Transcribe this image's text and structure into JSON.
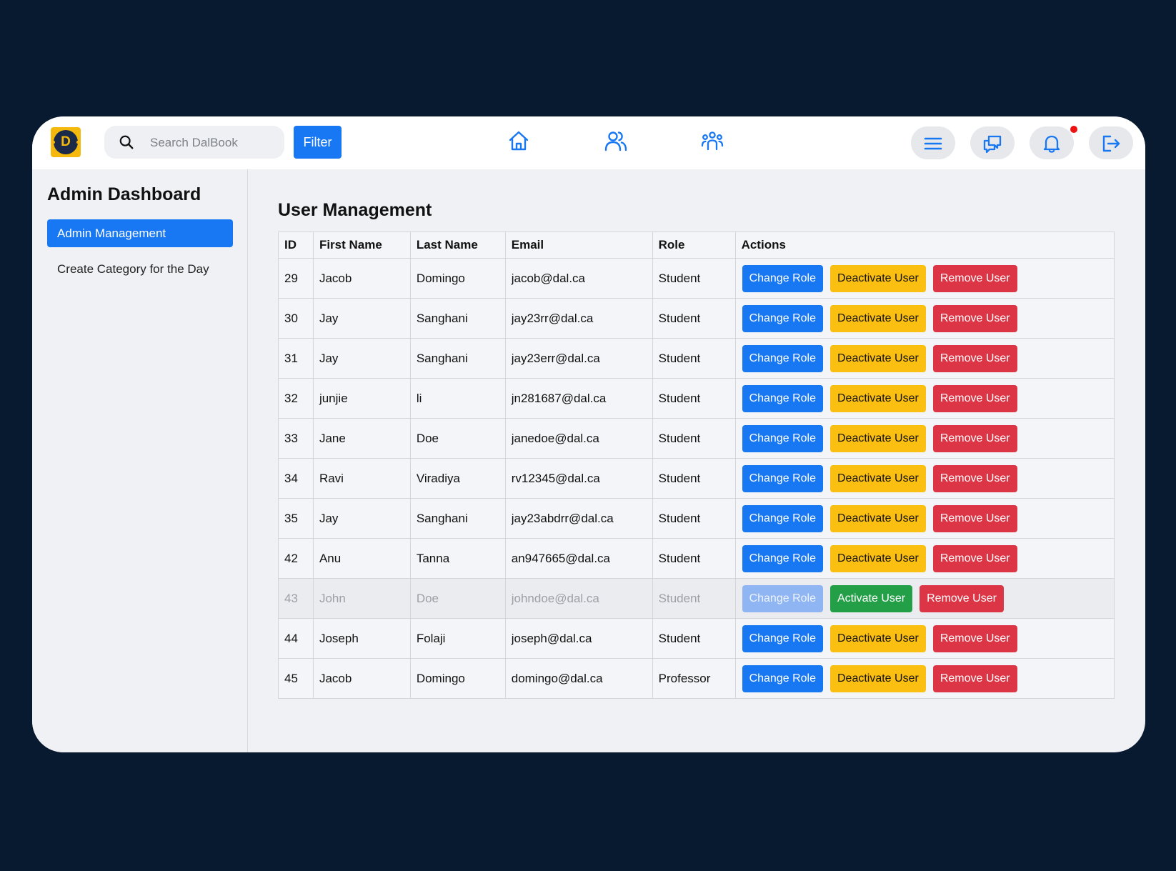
{
  "app": {
    "logo_letter": "D",
    "search_placeholder": "Search DalBook",
    "filter_label": "Filter",
    "nav_icons": [
      "home-icon",
      "friends-icon",
      "groups-icon"
    ],
    "toolbar_icons": [
      "menu-icon",
      "messages-icon",
      "bell-icon",
      "logout-icon"
    ],
    "notification_indicator": true
  },
  "sidebar": {
    "title": "Admin Dashboard",
    "items": [
      {
        "label": "Admin Management",
        "active": true
      },
      {
        "label": "Create Category for the Day",
        "active": false
      }
    ]
  },
  "main": {
    "title": "User Management",
    "columns": [
      "ID",
      "First Name",
      "Last Name",
      "Email",
      "Role",
      "Actions"
    ],
    "rows": [
      {
        "id": "29",
        "first": "Jacob",
        "last": "Domingo",
        "email": "jacob@dal.ca",
        "role": "Student",
        "status_action": "Deactivate User",
        "active": true
      },
      {
        "id": "30",
        "first": "Jay",
        "last": "Sanghani",
        "email": "jay23rr@dal.ca",
        "role": "Student",
        "status_action": "Deactivate User",
        "active": true
      },
      {
        "id": "31",
        "first": "Jay",
        "last": "Sanghani",
        "email": "jay23err@dal.ca",
        "role": "Student",
        "status_action": "Deactivate User",
        "active": true
      },
      {
        "id": "32",
        "first": "junjie",
        "last": "li",
        "email": "jn281687@dal.ca",
        "role": "Student",
        "status_action": "Deactivate User",
        "active": true
      },
      {
        "id": "33",
        "first": "Jane",
        "last": "Doe",
        "email": "janedoe@dal.ca",
        "role": "Student",
        "status_action": "Deactivate User",
        "active": true
      },
      {
        "id": "34",
        "first": "Ravi",
        "last": "Viradiya",
        "email": "rv12345@dal.ca",
        "role": "Student",
        "status_action": "Deactivate User",
        "active": true
      },
      {
        "id": "35",
        "first": "Jay",
        "last": "Sanghani",
        "email": "jay23abdrr@dal.ca",
        "role": "Student",
        "status_action": "Deactivate User",
        "active": true
      },
      {
        "id": "42",
        "first": "Anu",
        "last": "Tanna",
        "email": "an947665@dal.ca",
        "role": "Student",
        "status_action": "Deactivate User",
        "active": true
      },
      {
        "id": "43",
        "first": "John",
        "last": "Doe",
        "email": "johndoe@dal.ca",
        "role": "Student",
        "status_action": "Activate User",
        "active": false
      },
      {
        "id": "44",
        "first": "Joseph",
        "last": "Folaji",
        "email": "joseph@dal.ca",
        "role": "Student",
        "status_action": "Deactivate User",
        "active": true
      },
      {
        "id": "45",
        "first": "Jacob",
        "last": "Domingo",
        "email": "domingo@dal.ca",
        "role": "Professor",
        "status_action": "Deactivate User",
        "active": true
      }
    ],
    "change_role_label": "Change Role",
    "remove_label": "Remove User"
  },
  "colors": {
    "background": "#081a2f",
    "primary": "#1877f2",
    "warning": "#fbbf11",
    "success": "#23a047",
    "danger": "#dc3545",
    "notification": "#ee1111"
  }
}
